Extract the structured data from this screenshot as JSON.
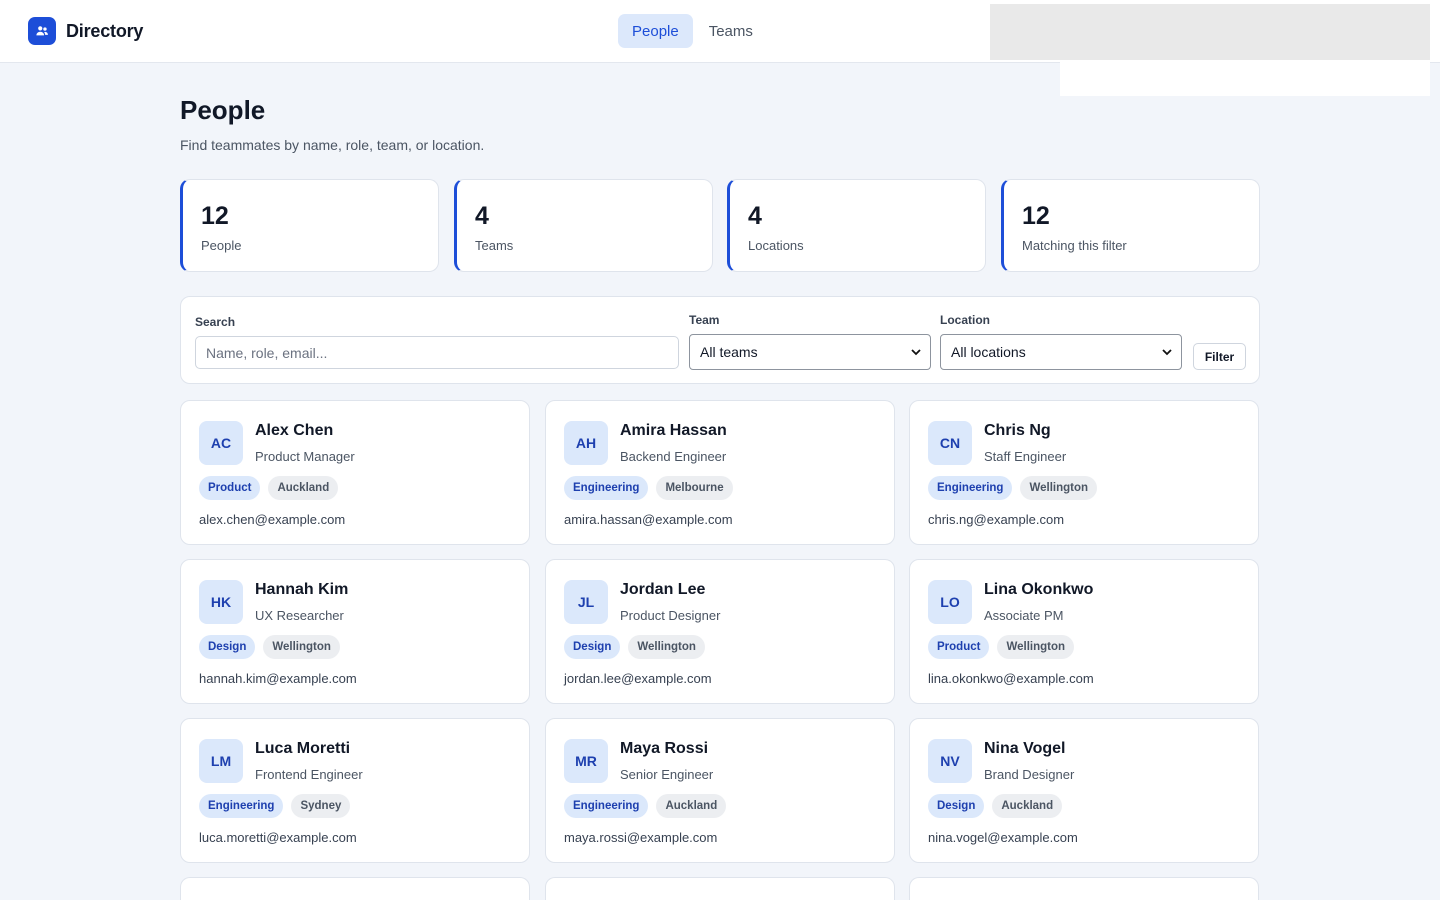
{
  "brand": {
    "name": "Directory",
    "icon": "users-icon",
    "accent": "#1d4ed8"
  },
  "nav": [
    {
      "label": "People",
      "active": true
    },
    {
      "label": "Teams",
      "active": false
    }
  ],
  "page": {
    "title": "People",
    "subtitle": "Find teammates by name, role, team, or location."
  },
  "stats": [
    {
      "value": "12",
      "label": "People"
    },
    {
      "value": "4",
      "label": "Teams"
    },
    {
      "value": "4",
      "label": "Locations"
    },
    {
      "value": "12",
      "label": "Matching this filter"
    }
  ],
  "filters": {
    "search_label": "Search",
    "search_placeholder": "Name, role, email...",
    "search_value": "",
    "team_label": "Team",
    "team_selected": "All teams",
    "location_label": "Location",
    "location_selected": "All locations",
    "button_label": "Filter"
  },
  "people": [
    {
      "initials": "AC",
      "name": "Alex Chen",
      "role": "Product Manager",
      "team": "Product",
      "location": "Auckland",
      "email": "alex.chen@example.com"
    },
    {
      "initials": "AH",
      "name": "Amira Hassan",
      "role": "Backend Engineer",
      "team": "Engineering",
      "location": "Melbourne",
      "email": "amira.hassan@example.com"
    },
    {
      "initials": "CN",
      "name": "Chris Ng",
      "role": "Staff Engineer",
      "team": "Engineering",
      "location": "Wellington",
      "email": "chris.ng@example.com"
    },
    {
      "initials": "HK",
      "name": "Hannah Kim",
      "role": "UX Researcher",
      "team": "Design",
      "location": "Wellington",
      "email": "hannah.kim@example.com"
    },
    {
      "initials": "JL",
      "name": "Jordan Lee",
      "role": "Product Designer",
      "team": "Design",
      "location": "Wellington",
      "email": "jordan.lee@example.com"
    },
    {
      "initials": "LO",
      "name": "Lina Okonkwo",
      "role": "Associate PM",
      "team": "Product",
      "location": "Wellington",
      "email": "lina.okonkwo@example.com"
    },
    {
      "initials": "LM",
      "name": "Luca Moretti",
      "role": "Frontend Engineer",
      "team": "Engineering",
      "location": "Sydney",
      "email": "luca.moretti@example.com"
    },
    {
      "initials": "MR",
      "name": "Maya Rossi",
      "role": "Senior Engineer",
      "team": "Engineering",
      "location": "Auckland",
      "email": "maya.rossi@example.com"
    },
    {
      "initials": "NV",
      "name": "Nina Vogel",
      "role": "Brand Designer",
      "team": "Design",
      "location": "Auckland",
      "email": "nina.vogel@example.com"
    }
  ]
}
